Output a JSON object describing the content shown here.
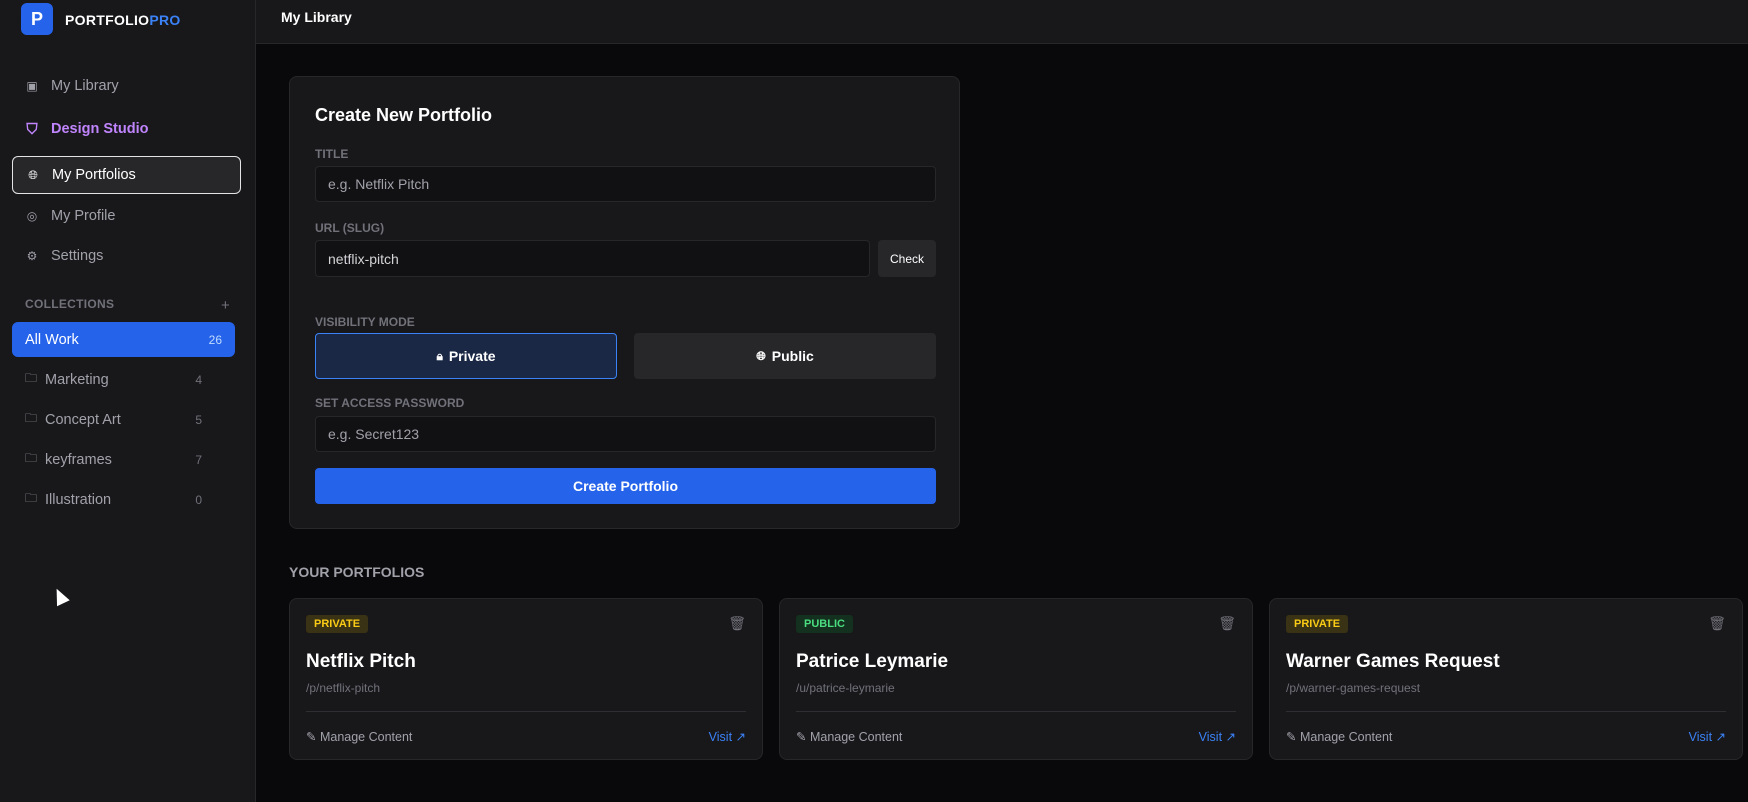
{
  "brand": {
    "logo_letter": "P",
    "name": "PORTFOLIO",
    "name_accent": "PRO"
  },
  "nav": [
    {
      "label": "My Library",
      "icon": "image-icon"
    },
    {
      "label": "Design Studio",
      "icon": "paint-roller-icon"
    },
    {
      "label": "My Portfolios",
      "icon": "globe-icon"
    },
    {
      "label": "My Profile",
      "icon": "user-circle-icon"
    },
    {
      "label": "Settings",
      "icon": "gear-icon"
    }
  ],
  "collections": {
    "heading": "COLLECTIONS",
    "add": "+",
    "items": [
      {
        "label": "All Work",
        "count": "26"
      },
      {
        "label": "Marketing",
        "count": "4"
      },
      {
        "label": "Concept Art",
        "count": "5"
      },
      {
        "label": "keyframes",
        "count": "7"
      },
      {
        "label": "Illustration",
        "count": "0"
      }
    ]
  },
  "header": {
    "title": "My Library"
  },
  "form": {
    "title": "Create New Portfolio",
    "title_label": "TITLE",
    "title_placeholder": "e.g. Netflix Pitch",
    "slug_label": "URL (SLUG)",
    "slug_value": "netflix-pitch",
    "check": "Check",
    "visibility_label": "VISIBILITY MODE",
    "private": "Private",
    "public": "Public",
    "password_label": "SET ACCESS PASSWORD",
    "password_placeholder": "e.g. Secret123",
    "submit": "Create Portfolio"
  },
  "portfolios_heading": "YOUR PORTFOLIOS",
  "portfolios": [
    {
      "badge": "PRIVATE",
      "title": "Netflix Pitch",
      "slug": "/p/netflix-pitch",
      "manage": "Manage Content",
      "visit": "Visit"
    },
    {
      "badge": "PUBLIC",
      "title": "Patrice Leymarie",
      "slug": "/u/patrice-leymarie",
      "manage": "Manage Content",
      "visit": "Visit"
    },
    {
      "badge": "PRIVATE",
      "title": "Warner Games Request",
      "slug": "/p/warner-games-request",
      "manage": "Manage Content",
      "visit": "Visit"
    }
  ]
}
